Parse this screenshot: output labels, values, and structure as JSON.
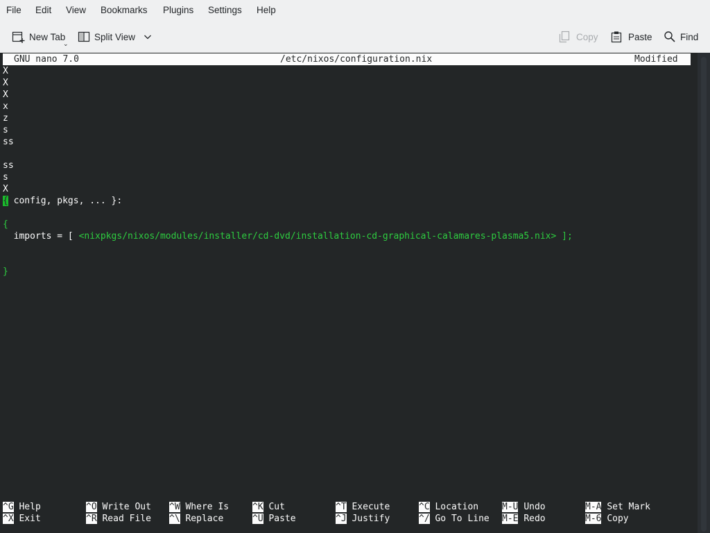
{
  "menu": [
    "File",
    "Edit",
    "View",
    "Bookmarks",
    "Plugins",
    "Settings",
    "Help"
  ],
  "toolbar": {
    "new_tab": "New Tab",
    "split_view": "Split View",
    "copy": "Copy",
    "paste": "Paste",
    "find": "Find"
  },
  "nano": {
    "version": "GNU nano 7.0",
    "filename": "/etc/nixos/configuration.nix",
    "status": "Modified"
  },
  "editor_lines": {
    "l1": "X",
    "l2": "X",
    "l3": "X",
    "l4": "x",
    "l5": "z",
    "l6": "s",
    "l7": "ss",
    "l9": "ss",
    "l10": "s",
    "l11": "X",
    "args_open": "{",
    "args_body": " config, pkgs, ... }:",
    "body_open": "{",
    "imports_kw": "  imports = [ ",
    "imports_path": "<nixpkgs/nixos/modules/installer/cd-dvd/installation-cd-graphical-calamares-plasma5.nix>",
    "imports_close": " ];",
    "body_close": "}"
  },
  "shortcuts": [
    {
      "key": "^G",
      "label": "Help"
    },
    {
      "key": "^X",
      "label": "Exit"
    },
    {
      "key": "^O",
      "label": "Write Out"
    },
    {
      "key": "^R",
      "label": "Read File"
    },
    {
      "key": "^W",
      "label": "Where Is"
    },
    {
      "key": "^\\",
      "label": "Replace"
    },
    {
      "key": "^K",
      "label": "Cut"
    },
    {
      "key": "^U",
      "label": "Paste"
    },
    {
      "key": "^T",
      "label": "Execute"
    },
    {
      "key": "^J",
      "label": "Justify"
    },
    {
      "key": "^C",
      "label": "Location"
    },
    {
      "key": "^/",
      "label": "Go To Line"
    },
    {
      "key": "M-U",
      "label": "Undo"
    },
    {
      "key": "M-E",
      "label": "Redo"
    },
    {
      "key": "M-A",
      "label": "Set Mark"
    },
    {
      "key": "M-6",
      "label": "Copy"
    }
  ],
  "colors": {
    "terminal_bg": "#232627",
    "terminal_fg": "#fcfcfc",
    "syntax_green": "#2ecc40",
    "window_bg": "#eff0f1"
  },
  "icons": [
    "new-tab-icon",
    "split-view-icon",
    "chevron-down-icon",
    "copy-icon",
    "paste-icon",
    "search-icon"
  ]
}
